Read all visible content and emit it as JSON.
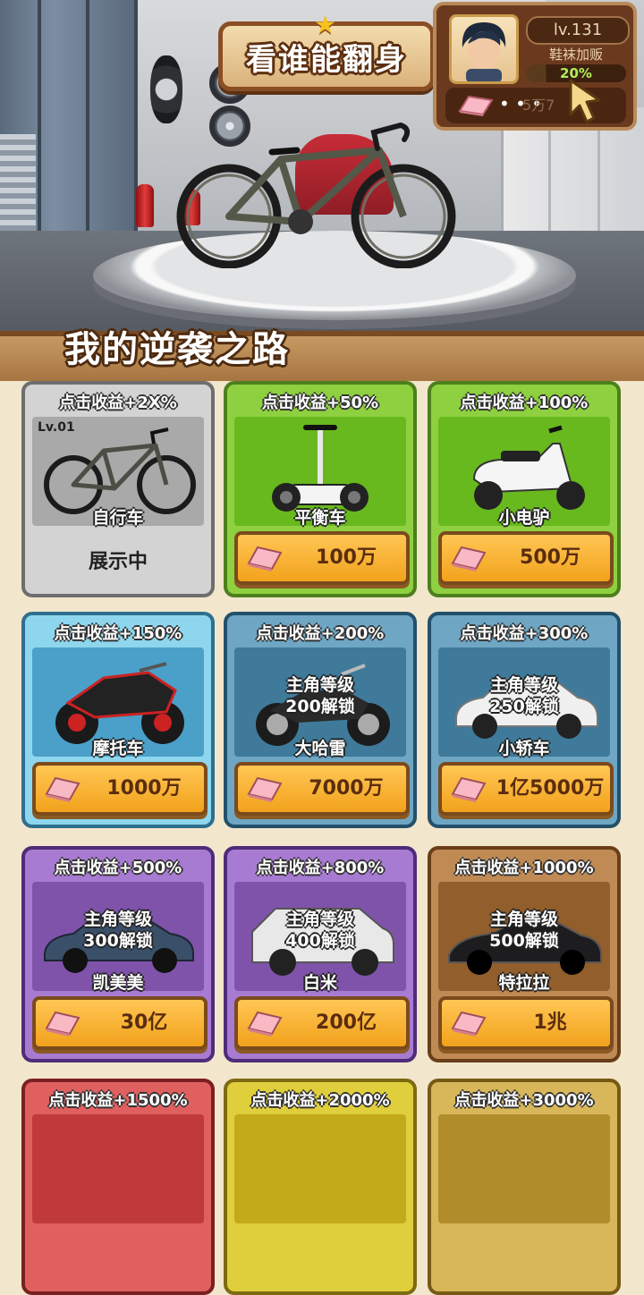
{
  "header": {
    "title": "看谁能翻身",
    "section_title": "我的逆袭之路"
  },
  "profile": {
    "level": "lv.131",
    "name": "鞋袜加贩",
    "progress_label": "20%",
    "progress": 0.2,
    "money": "5万7"
  },
  "vehicles": [
    {
      "bonus": "点击收益+2X%",
      "name": "自行车",
      "level_tag": "Lv.01",
      "status": "展示中",
      "theme": "gray",
      "icon": "bicycle-icon"
    },
    {
      "bonus": "点击收益+50%",
      "name": "平衡车",
      "price": "100万",
      "theme": "green",
      "icon": "balance-scooter-icon"
    },
    {
      "bonus": "点击收益+100%",
      "name": "小电驴",
      "price": "500万",
      "theme": "green",
      "icon": "e-scooter-icon"
    },
    {
      "bonus": "点击收益+150%",
      "name": "摩托车",
      "price": "1000万",
      "theme": "cyan",
      "icon": "motorcycle-icon"
    },
    {
      "bonus": "点击收益+200%",
      "name": "大哈雷",
      "price": "7000万",
      "lock_line1": "主角等级",
      "lock_line2": "200解锁",
      "theme": "teal",
      "icon": "harley-icon"
    },
    {
      "bonus": "点击收益+300%",
      "name": "小轿车",
      "price": "1亿5000万",
      "lock_line1": "主角等级",
      "lock_line2": "250解锁",
      "theme": "teal",
      "icon": "sedan-icon"
    },
    {
      "bonus": "点击收益+500%",
      "name": "凯美美",
      "price": "30亿",
      "lock_line1": "主角等级",
      "lock_line2": "300解锁",
      "theme": "purple",
      "icon": "camry-icon"
    },
    {
      "bonus": "点击收益+800%",
      "name": "白米",
      "price": "200亿",
      "lock_line1": "主角等级",
      "lock_line2": "400解锁",
      "theme": "purple",
      "icon": "suv-icon"
    },
    {
      "bonus": "点击收益+1000%",
      "name": "特拉拉",
      "price": "1兆",
      "lock_line1": "主角等级",
      "lock_line2": "500解锁",
      "theme": "brown",
      "icon": "sports-car-icon"
    },
    {
      "bonus": "点击收益+1500%",
      "theme": "red"
    },
    {
      "bonus": "点击收益+2000%",
      "theme": "yellow"
    },
    {
      "bonus": "点击收益+3000%",
      "theme": "olive"
    }
  ]
}
